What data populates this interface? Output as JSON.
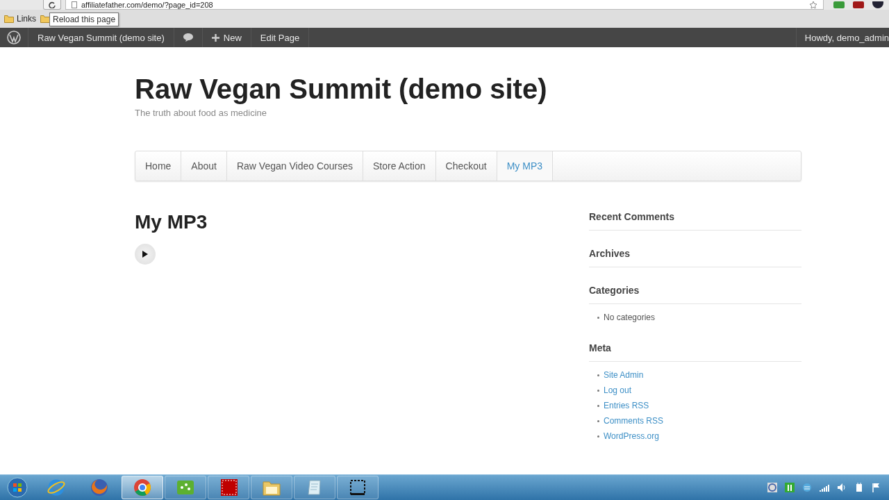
{
  "browser": {
    "url": "affiliatefather.com/demo/?page_id=208",
    "bookmarks": [
      {
        "label": "Links"
      }
    ],
    "tooltip": "Reload this page"
  },
  "admin_bar": {
    "items": [
      {
        "kind": "logo"
      },
      {
        "kind": "site",
        "label": "Raw Vegan Summit (demo site)"
      },
      {
        "kind": "comments"
      },
      {
        "kind": "new",
        "label": "New"
      },
      {
        "kind": "link",
        "label": "Edit Page"
      }
    ],
    "account": "Howdy, demo_admin"
  },
  "site": {
    "title": "Raw Vegan Summit (demo site)",
    "tagline": "The truth about food as medicine"
  },
  "nav": [
    {
      "label": "Home",
      "selected": false
    },
    {
      "label": "About",
      "selected": false
    },
    {
      "label": "Raw Vegan Video Courses",
      "selected": false
    },
    {
      "label": "Store Action",
      "selected": false
    },
    {
      "label": "Checkout",
      "selected": false
    },
    {
      "label": "My MP3",
      "selected": true
    }
  ],
  "page": {
    "title": "My MP3"
  },
  "sidebar": [
    {
      "title": "Recent Comments"
    },
    {
      "title": "Archives"
    },
    {
      "title": "Categories",
      "items": [
        {
          "kind": "text",
          "label": "No categories"
        }
      ]
    },
    {
      "title": "Meta",
      "items": [
        {
          "kind": "link",
          "label": "Site Admin"
        },
        {
          "kind": "link",
          "label": "Log out"
        },
        {
          "kind": "link",
          "label": "Entries RSS"
        },
        {
          "kind": "link",
          "label": "Comments RSS"
        },
        {
          "kind": "link",
          "label": "WordPress.org"
        }
      ]
    }
  ],
  "taskbar": {
    "apps": [
      {
        "kind": "ie",
        "selected": false
      },
      {
        "kind": "firefox",
        "selected": false
      },
      {
        "kind": "chrome",
        "selected": true
      },
      {
        "kind": "dots",
        "selected": false
      },
      {
        "kind": "ftp",
        "selected": false
      },
      {
        "kind": "folder",
        "selected": false
      },
      {
        "kind": "notepad",
        "selected": false
      },
      {
        "kind": "snip",
        "selected": false
      }
    ]
  }
}
